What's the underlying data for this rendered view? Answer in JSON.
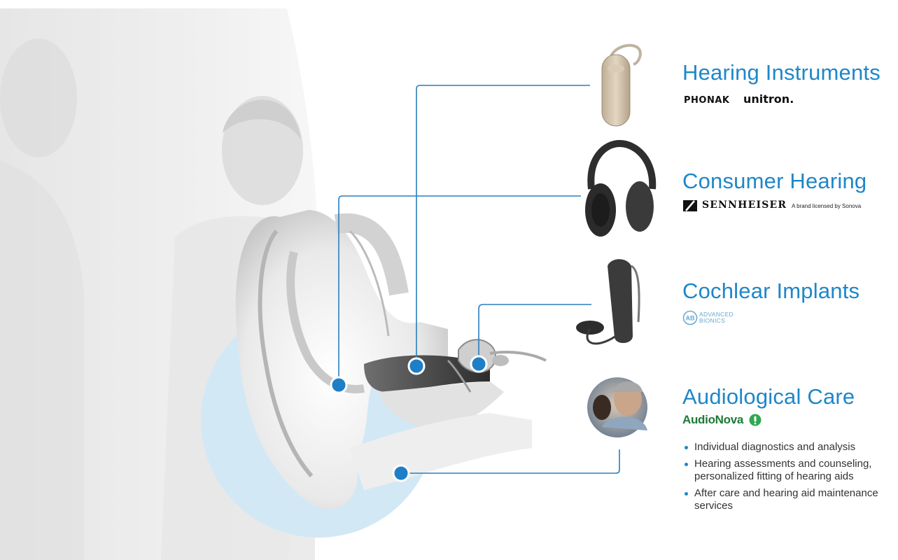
{
  "segments": [
    {
      "title": "Hearing Instruments",
      "product_icon": "hearing-aid-icon",
      "brands": [
        "PHONAK",
        "unitron."
      ]
    },
    {
      "title": "Consumer Hearing",
      "product_icon": "headphones-icon",
      "brands": [
        "SENNHEISER"
      ],
      "brand_note": "A brand licensed by Sonova"
    },
    {
      "title": "Cochlear Implants",
      "product_icon": "cochlear-implant-icon",
      "brands": [
        "ADVANCED",
        "BIONICS"
      ],
      "brand_logo_text": "AB"
    },
    {
      "title": "Audiological Care",
      "product_icon": "audiologist-photo-icon",
      "brands": [
        "AudioNova"
      ],
      "bullets": [
        "Individual diagnostics and analysis",
        "Hearing assessments and counseling, personalized fitting of hearing aids",
        "After care and hearing aid maintenance services"
      ]
    }
  ],
  "colors": {
    "accent": "#1e87c8",
    "connector": "#2a7fbc",
    "circle": "#d3e8f5",
    "audionova_green": "#1c7a35",
    "ab_blue": "#6aa7cf"
  },
  "background_image": "ear-anatomy-illustration"
}
